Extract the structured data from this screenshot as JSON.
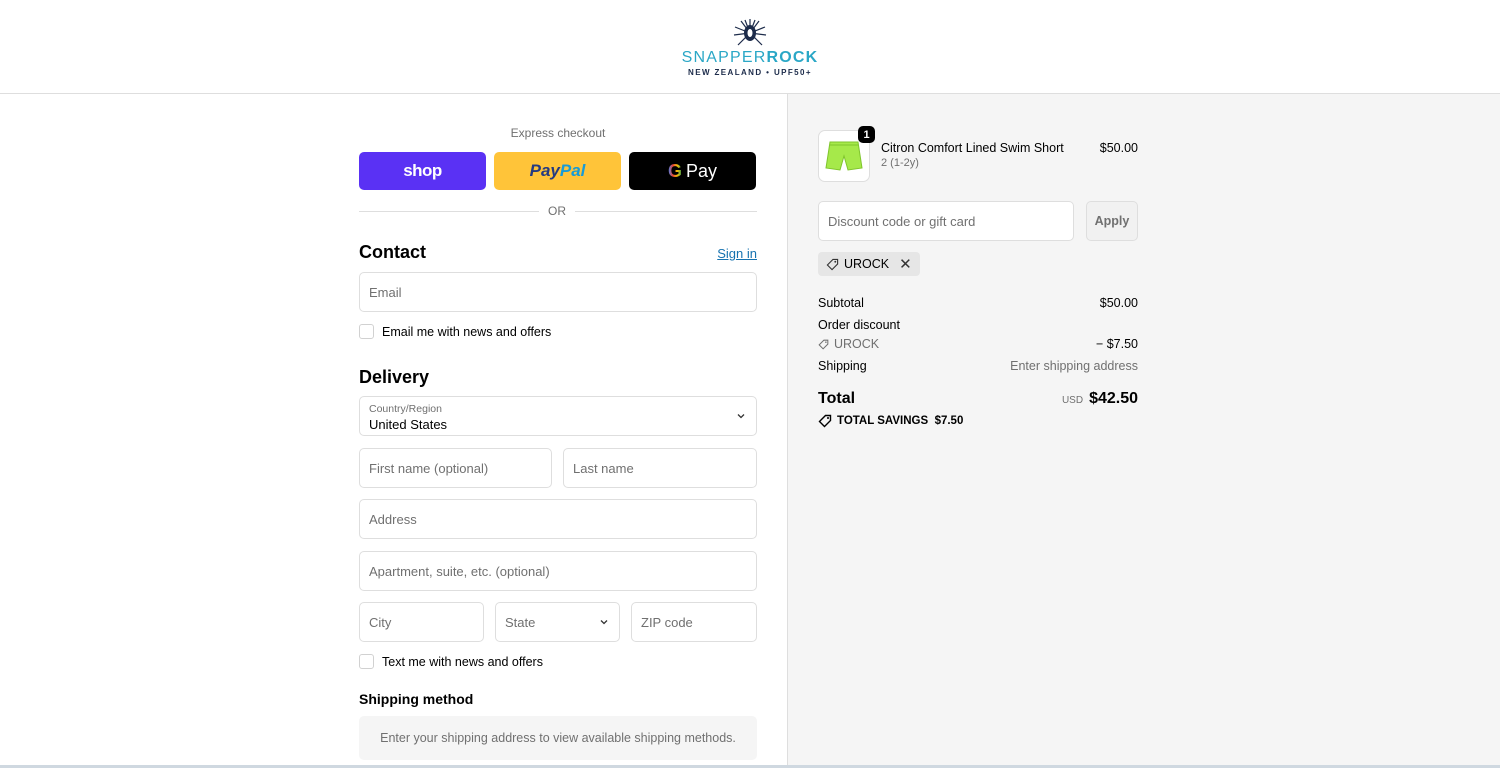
{
  "header": {
    "logo_part1": "SNAPPER",
    "logo_part2": "ROCK",
    "logo_tagline": "NEW ZEALAND • UPF50+"
  },
  "express": {
    "title": "Express checkout",
    "shop_label": "shop",
    "paypal_part1": "Pay",
    "paypal_part2": "Pal",
    "gpay_g": "G",
    "gpay_label": "Pay",
    "or_label": "OR"
  },
  "contact": {
    "heading": "Contact",
    "sign_in": "Sign in",
    "email_placeholder": "Email",
    "news_label": "Email me with news and offers"
  },
  "delivery": {
    "heading": "Delivery",
    "country_label": "Country/Region",
    "country_value": "United States",
    "first_name_placeholder": "First name (optional)",
    "last_name_placeholder": "Last name",
    "address_placeholder": "Address",
    "apartment_placeholder": "Apartment, suite, etc. (optional)",
    "city_placeholder": "City",
    "state_placeholder": "State",
    "zip_placeholder": "ZIP code",
    "text_label": "Text me with news and offers"
  },
  "shipping_method": {
    "heading": "Shipping method",
    "message": "Enter your shipping address to view available shipping methods."
  },
  "summary": {
    "product": {
      "quantity": "1",
      "name": "Citron Comfort Lined Swim Short",
      "variant": "2 (1-2y)",
      "price": "$50.00",
      "color": "#a6e94a"
    },
    "discount_placeholder": "Discount code or gift card",
    "apply_label": "Apply",
    "applied_code": "UROCK",
    "subtotal_label": "Subtotal",
    "subtotal_value": "$50.00",
    "order_discount_label": "Order discount",
    "discount_code": "UROCK",
    "discount_value": "− $7.50",
    "shipping_label": "Shipping",
    "shipping_value": "Enter shipping address",
    "total_label": "Total",
    "currency": "USD",
    "total_value": "$42.50",
    "savings_label": "TOTAL SAVINGS",
    "savings_value": "$7.50"
  },
  "colors": {
    "shop_pay": "#5a31f4",
    "paypal": "#ffc439",
    "link": "#1773b0",
    "brand": "#2aa7c6"
  }
}
